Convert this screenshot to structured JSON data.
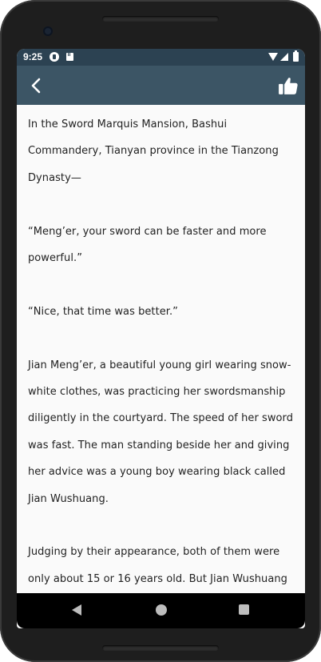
{
  "status_bar": {
    "time": "9:25",
    "icons": [
      "app-notification-icon",
      "sd-card-icon",
      "wifi-icon",
      "signal-icon",
      "battery-icon"
    ]
  },
  "app_bar": {
    "back_icon": "chevron-left-icon",
    "action_icon": "thumbs-up-icon",
    "color": "#3c5565"
  },
  "content": {
    "paragraphs": [
      "In the Sword Marquis Mansion, Bashui Commandery, Tianyan province in the Tianzong Dynasty—",
      "“Meng’er, your sword can be faster and more powerful.”",
      "“Nice, that time was better.”",
      "Jian Meng’er, a beautiful young girl wearing snow-white clothes, was practicing her swordsmanship diligently in the courtyard. The speed of her sword was fast. The man standing beside her and giving her advice was a young boy wearing black called Jian Wushuang.",
      "Judging by their appearance, both of them were only about 15 or 16 years old. But Jian Wushuang"
    ]
  },
  "nav_bar": {
    "icons": [
      "nav-back-icon",
      "nav-home-icon",
      "nav-recents-icon"
    ]
  },
  "colors": {
    "status_bar": "#2c4252",
    "app_bar": "#3c5565",
    "background": "#fafafa",
    "text": "#222222"
  }
}
